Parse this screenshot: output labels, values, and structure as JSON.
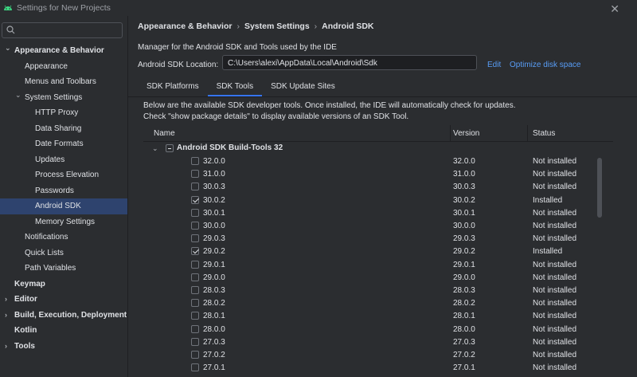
{
  "window": {
    "title": "Settings for New Projects",
    "close_glyph": "✕"
  },
  "search": {
    "placeholder": ""
  },
  "tree": [
    {
      "label": "Appearance & Behavior",
      "indent": 0,
      "expanded": true,
      "bold": true
    },
    {
      "label": "Appearance",
      "indent": 1
    },
    {
      "label": "Menus and Toolbars",
      "indent": 1
    },
    {
      "label": "System Settings",
      "indent": 1,
      "expanded": true
    },
    {
      "label": "HTTP Proxy",
      "indent": 2
    },
    {
      "label": "Data Sharing",
      "indent": 2
    },
    {
      "label": "Date Formats",
      "indent": 2
    },
    {
      "label": "Updates",
      "indent": 2
    },
    {
      "label": "Process Elevation",
      "indent": 2
    },
    {
      "label": "Passwords",
      "indent": 2
    },
    {
      "label": "Android SDK",
      "indent": 2,
      "selected": true
    },
    {
      "label": "Memory Settings",
      "indent": 2
    },
    {
      "label": "Notifications",
      "indent": 1
    },
    {
      "label": "Quick Lists",
      "indent": 1
    },
    {
      "label": "Path Variables",
      "indent": 1
    },
    {
      "label": "Keymap",
      "indent": 0,
      "bold": true
    },
    {
      "label": "Editor",
      "indent": 0,
      "expanded": false,
      "bold": true
    },
    {
      "label": "Build, Execution, Deployment",
      "indent": 0,
      "expanded": false,
      "bold": true
    },
    {
      "label": "Kotlin",
      "indent": 0,
      "bold": true
    },
    {
      "label": "Tools",
      "indent": 0,
      "expanded": false,
      "bold": true
    }
  ],
  "breadcrumb": [
    "Appearance & Behavior",
    "System Settings",
    "Android SDK"
  ],
  "description": "Manager for the Android SDK and Tools used by the IDE",
  "sdk_location": {
    "label": "Android SDK Location:",
    "value": "C:\\Users\\alexi\\AppData\\Local\\Android\\Sdk",
    "edit_link": "Edit",
    "optimize_link": "Optimize disk space"
  },
  "tabs": [
    {
      "label": "SDK Platforms",
      "active": false
    },
    {
      "label": "SDK Tools",
      "active": true
    },
    {
      "label": "SDK Update Sites",
      "active": false
    }
  ],
  "info_text": "Below are the available SDK developer tools. Once installed, the IDE will automatically check for updates. Check \"show package details\" to display available versions of an SDK Tool.",
  "table": {
    "columns": [
      "Name",
      "Version",
      "Status"
    ],
    "group": "Android SDK Build-Tools 32",
    "rows": [
      {
        "name": "32.0.0",
        "version": "32.0.0",
        "status": "Not installed",
        "checked": false
      },
      {
        "name": "31.0.0",
        "version": "31.0.0",
        "status": "Not installed",
        "checked": false
      },
      {
        "name": "30.0.3",
        "version": "30.0.3",
        "status": "Not installed",
        "checked": false
      },
      {
        "name": "30.0.2",
        "version": "30.0.2",
        "status": "Installed",
        "checked": true
      },
      {
        "name": "30.0.1",
        "version": "30.0.1",
        "status": "Not installed",
        "checked": false
      },
      {
        "name": "30.0.0",
        "version": "30.0.0",
        "status": "Not installed",
        "checked": false
      },
      {
        "name": "29.0.3",
        "version": "29.0.3",
        "status": "Not installed",
        "checked": false
      },
      {
        "name": "29.0.2",
        "version": "29.0.2",
        "status": "Installed",
        "checked": true
      },
      {
        "name": "29.0.1",
        "version": "29.0.1",
        "status": "Not installed",
        "checked": false
      },
      {
        "name": "29.0.0",
        "version": "29.0.0",
        "status": "Not installed",
        "checked": false
      },
      {
        "name": "28.0.3",
        "version": "28.0.3",
        "status": "Not installed",
        "checked": false
      },
      {
        "name": "28.0.2",
        "version": "28.0.2",
        "status": "Not installed",
        "checked": false
      },
      {
        "name": "28.0.1",
        "version": "28.0.1",
        "status": "Not installed",
        "checked": false
      },
      {
        "name": "28.0.0",
        "version": "28.0.0",
        "status": "Not installed",
        "checked": false
      },
      {
        "name": "27.0.3",
        "version": "27.0.3",
        "status": "Not installed",
        "checked": false
      },
      {
        "name": "27.0.2",
        "version": "27.0.2",
        "status": "Not installed",
        "checked": false
      },
      {
        "name": "27.0.1",
        "version": "27.0.1",
        "status": "Not installed",
        "checked": false
      }
    ]
  },
  "colors": {
    "accent": "#3574f0",
    "link": "#589df6",
    "selection": "#2e436e",
    "background": "#2b2d30"
  }
}
